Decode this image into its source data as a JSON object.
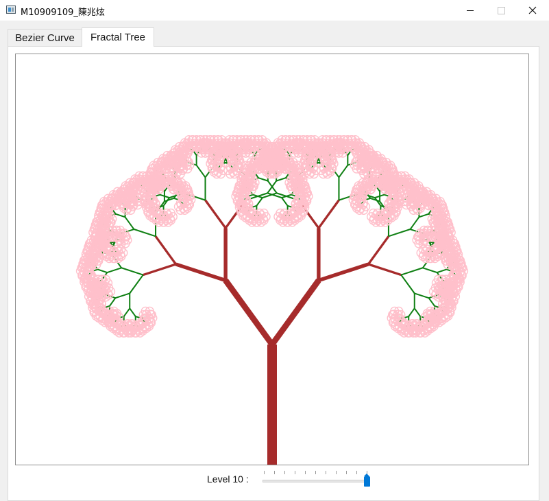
{
  "window": {
    "title": "M10909109_陳兆炫",
    "icon": "app-window-icon",
    "controls": [
      "minimize-icon",
      "maximize-icon",
      "close-icon"
    ]
  },
  "tabs": [
    {
      "label": "Bezier Curve",
      "selected": false
    },
    {
      "label": "Fractal Tree",
      "selected": true
    }
  ],
  "fractal_tree": {
    "level": 10,
    "trunk_color": "#a62b2b",
    "branch_color": "#0e7f12",
    "blossom_color": "#ffc0cb",
    "background": "#ffffff"
  },
  "level_control": {
    "label": "Level 10 :",
    "min": 0,
    "max": 10,
    "value": 10,
    "accent": "#0078d7"
  }
}
